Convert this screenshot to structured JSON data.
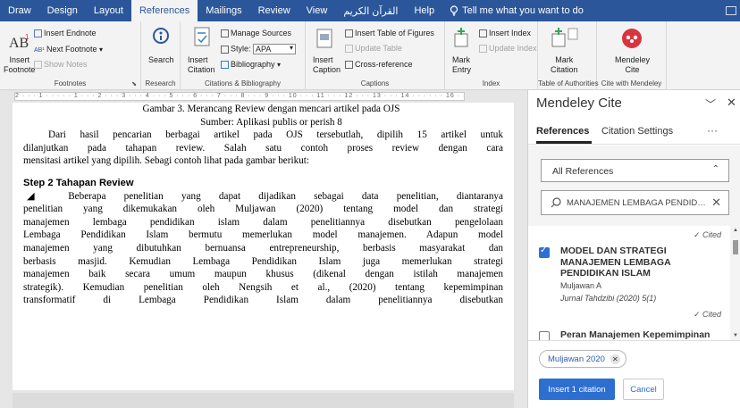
{
  "menu": {
    "tabs": [
      "Draw",
      "Design",
      "Layout",
      "References",
      "Mailings",
      "Review",
      "View",
      "القرآن الكريم",
      "Help"
    ],
    "active_tab": "References",
    "tell_me": "Tell me what you want to do"
  },
  "ribbon": {
    "footnotes": {
      "insert_footnote": "Insert\nFootnote",
      "insert_endnote": "Insert Endnote",
      "next_footnote": "Next Footnote",
      "show_notes": "Show Notes",
      "label": "Footnotes"
    },
    "research": {
      "search": "Search",
      "label": "Research"
    },
    "citations": {
      "insert_citation": "Insert\nCitation",
      "manage_sources": "Manage Sources",
      "style_label": "Style:",
      "style_value": "APA",
      "bibliography": "Bibliography",
      "label": "Citations & Bibliography"
    },
    "captions": {
      "insert_caption": "Insert\nCaption",
      "insert_table_of_figures": "Insert Table of Figures",
      "update_table": "Update Table",
      "cross_reference": "Cross-reference",
      "label": "Captions"
    },
    "index": {
      "mark_entry": "Mark\nEntry",
      "insert_index": "Insert Index",
      "update_index": "Update Index",
      "label": "Index"
    },
    "toa": {
      "mark_citation": "Mark\nCitation",
      "label": "Table of Authorities"
    },
    "mendeley": {
      "button": "Mendeley\nCite",
      "label": "Cite with Mendeley"
    },
    "colors": {
      "ribbon_blue": "#2b579a",
      "mendeley_red": "#d8343f"
    }
  },
  "ruler": {
    "text": "2 · · · 1 · · · · · 1 · · · 2 · · · 3 · · · 4 · · · 5 · · · 6 · · · 7 · · · 8 · · · 9 · · · 10 · · · 11 · · · 12 · · · 13 · · · 14 · · · · · · 16 · · · 17 · · ·"
  },
  "document": {
    "caption_line1": "Gambar 3. Merancang Review dengan mencari artikel pada OJS",
    "caption_line2": "Sumber: Aplikasi publis or perish 8",
    "p1": [
      "Dari hasil pencarian berbagai artikel pada OJS tersebutlah, dipilih 15 artikel untuk",
      "dilanjutkan pada tahapan review. Salah satu contoh proses review dengan cara",
      "mensitasi artikel yang dipilih. Sebagi contoh lihat pada gambar berikut:"
    ],
    "heading": "Step 2 Tahapan Review",
    "p2": [
      "◢ Beberapa penelitian yang dapat dijadikan sebagai data penelitian, diantaranya",
      "penelitian yang dikemukakan oleh Muljawan (2020) tentang model dan strategi",
      "manajemen lembaga pendidikan islam dalam penelitiannya disebutkan pengelolaan",
      "Lembaga Pendidikan Islam bermutu memerlukan model manajemen. Adapun model",
      "manajemen yang dibutuhkan bernuansa entrepreneurship, berbasis masyarakat dan",
      "berbasis masjid. Kemudian Lembaga Pendidikan Islam juga memerlukan strategi",
      "manajemen baik secara umum maupun khusus (dikenal dengan istilah manajemen",
      "strategik). Kemudian penelitian oleh Nengsih et al., (2020) tentang kepemimpinan",
      "transformatif di Lembaga Pendidikan Islam dalam penelitiannya disebutkan"
    ]
  },
  "mendeley_panel": {
    "title": "Mendeley Cite",
    "tabs": [
      "References",
      "Citation Settings"
    ],
    "more": "···",
    "filter_value": "All References",
    "search_value": "MANAJEMEN LEMBAGA PENDIDIKAN ISLAM",
    "results": [
      {
        "cited": "✓ Cited",
        "title": "MODEL DAN STRATEGI MANAJEMEN LEMBAGA PENDIDIKAN ISLAM",
        "author": "Muljawan A",
        "journal": "Jurnal Tahdzibi (2020) 5(1)",
        "checked": true
      },
      {
        "cited": "✓ Cited",
        "title": "Peran Manajemen Kepemimpinan",
        "checked": false
      }
    ],
    "selected_chip": "Muljawan 2020",
    "insert_button": "Insert 1 citation",
    "cancel_button": "Cancel",
    "colors": {
      "accent": "#2d6ed1"
    }
  }
}
